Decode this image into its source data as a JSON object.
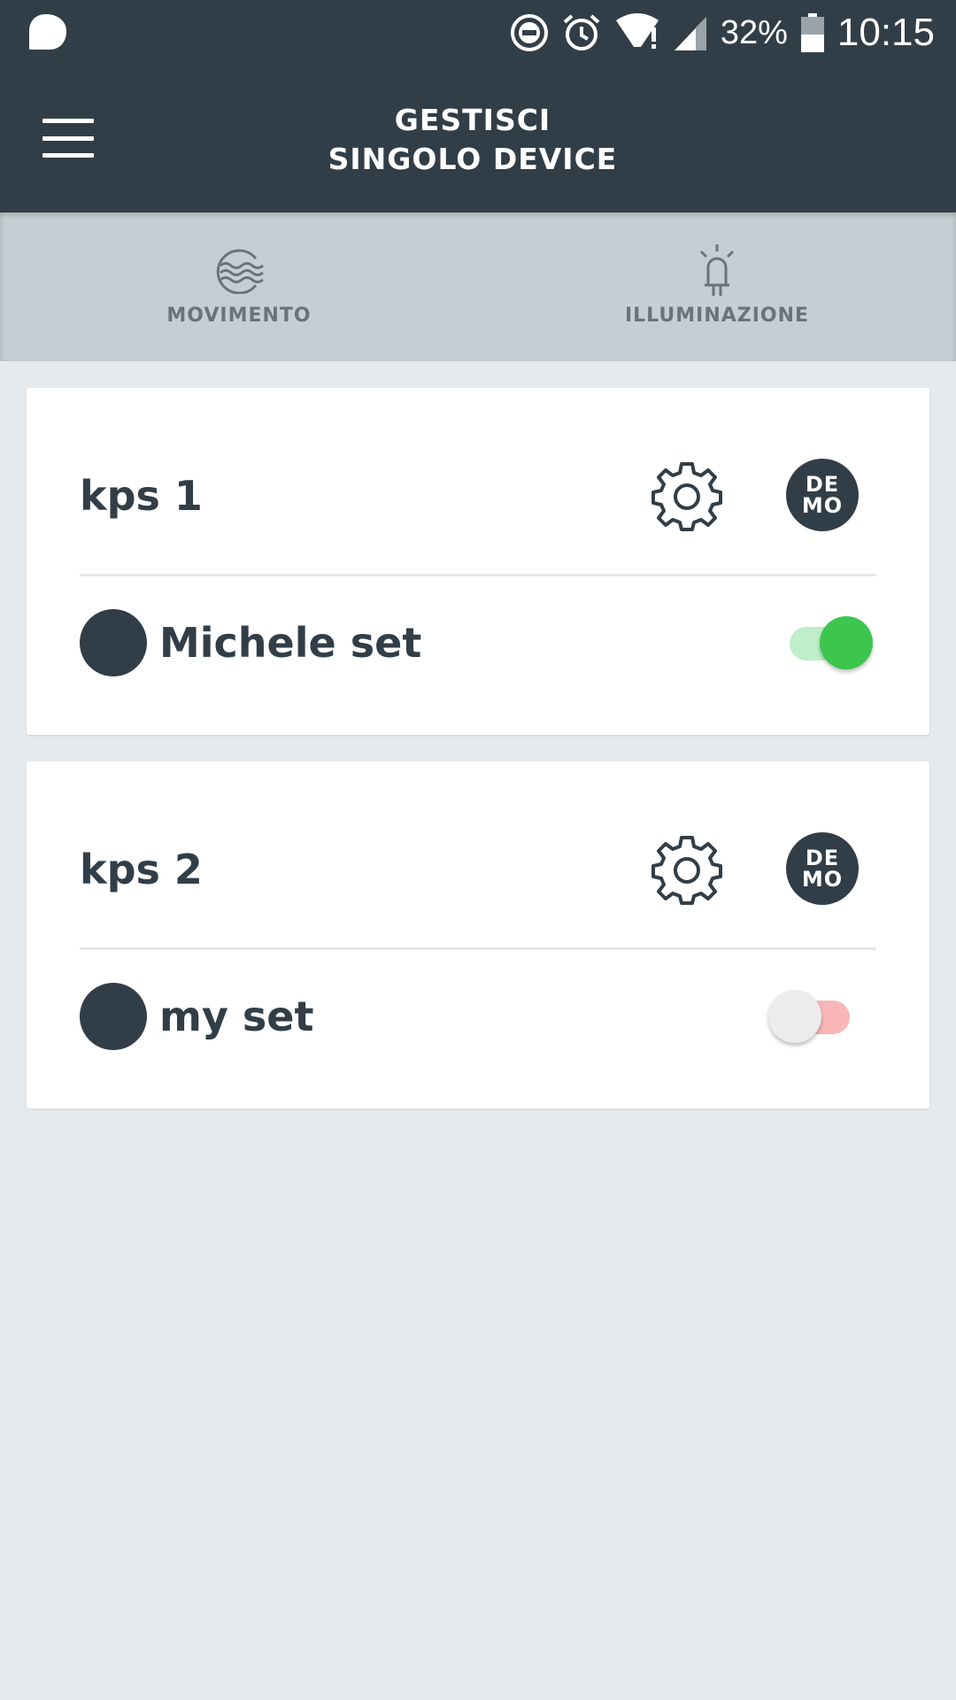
{
  "status_bar": {
    "battery": "32%",
    "time": "10:15",
    "icons": [
      "notification-bubble-icon",
      "do-not-disturb-icon",
      "alarm-icon",
      "wifi-icon",
      "signal-icon",
      "battery-icon"
    ]
  },
  "app_bar": {
    "title_line1": "GESTISCI",
    "title_line2": "SINGOLO DEVICE",
    "menu_icon": "hamburger-menu-icon"
  },
  "tabs": [
    {
      "label": "MOVIMENTO",
      "icon": "waves-icon"
    },
    {
      "label": "ILLUMINAZIONE",
      "icon": "light-bulb-icon"
    }
  ],
  "devices": [
    {
      "name": "kps 1",
      "badge_line1": "DE",
      "badge_line2": "MO",
      "set_name": "Michele set",
      "enabled": true
    },
    {
      "name": "kps 2",
      "badge_line1": "DE",
      "badge_line2": "MO",
      "set_name": "my set",
      "enabled": false
    }
  ],
  "colors": {
    "header": "#323e47",
    "tab_bar": "#c5cfd3",
    "background": "#e6eaed",
    "toggle_on": "#3cc64e",
    "toggle_on_track": "#bfeec9",
    "toggle_off_track": "#f8b6b6"
  }
}
